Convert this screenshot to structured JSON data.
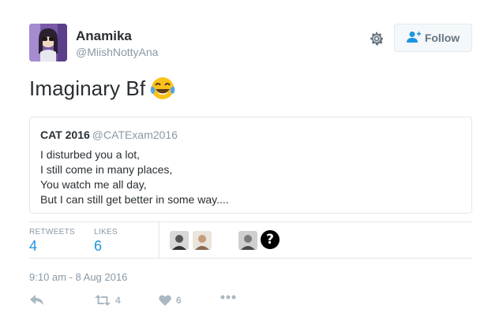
{
  "author": {
    "name": "Anamika",
    "handle": "@MiishNottyAna"
  },
  "follow_button": {
    "label": "Follow"
  },
  "icons": {
    "settings": "gear-icon",
    "follow": "add-user-icon",
    "emoji": "face-with-tears-of-joy",
    "reply": "reply-icon",
    "retweet": "retweet-icon",
    "like": "heart-icon",
    "more": "more-dots-icon"
  },
  "tweet": {
    "text": "Imaginary Bf"
  },
  "quoted": {
    "name": "CAT 2016",
    "handle": "@CATExam2016",
    "lines": [
      "I disturbed you a lot,",
      "I still come in many places,",
      "You watch me all day,",
      "But I can still get better in some way...."
    ]
  },
  "stats": {
    "retweets_label": "RETWEETS",
    "retweets_value": "4",
    "likes_label": "LIKES",
    "likes_value": "6"
  },
  "timestamp": "9:10 am - 8 Aug 2016",
  "actions": {
    "retweet_count": "4",
    "like_count": "6"
  },
  "colors": {
    "text": "#292f33",
    "muted": "#8899a6",
    "link_blue": "#1b95e0",
    "border": "#e1e8ed",
    "action_grey": "#aab8c2"
  }
}
